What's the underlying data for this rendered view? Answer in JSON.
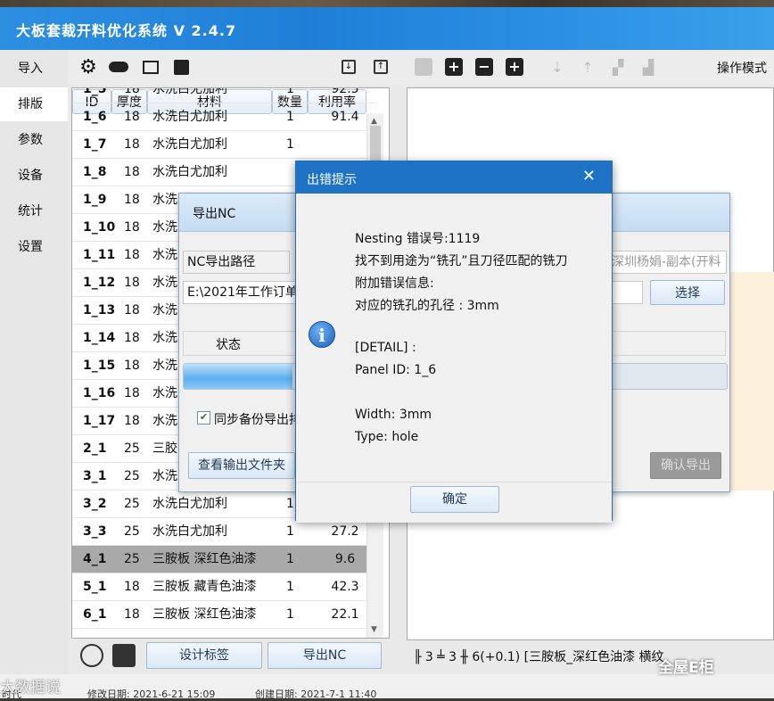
{
  "app": {
    "title": "大板套裁开料优化系统 V 2.4.7"
  },
  "nav": {
    "items": [
      "导入",
      "排版",
      "参数",
      "设备",
      "统计",
      "设置"
    ]
  },
  "toolbar": {
    "ops_mode": "操作模式"
  },
  "table": {
    "headers": [
      "ID",
      "厚度",
      "材料",
      "数量",
      "利用率"
    ],
    "top_partial": {
      "id": "1_5",
      "thickness": "18",
      "material": "水洗白尤加利",
      "qty": "1",
      "util": "92.5"
    },
    "rows": [
      {
        "id": "1_6",
        "thickness": "18",
        "material": "水洗白尤加利",
        "qty": "1",
        "util": "91.4"
      },
      {
        "id": "1_7",
        "thickness": "18",
        "material": "水洗白尤加利",
        "qty": "1",
        "util": ""
      },
      {
        "id": "1_8",
        "thickness": "18",
        "material": "水洗白尤加利",
        "qty": "",
        "util": ""
      },
      {
        "id": "1_9",
        "thickness": "18",
        "material": "水洗",
        "qty": "",
        "util": ""
      },
      {
        "id": "1_10",
        "thickness": "18",
        "material": "水洗",
        "qty": "",
        "util": ""
      },
      {
        "id": "1_11",
        "thickness": "18",
        "material": "水洗",
        "qty": "",
        "util": ""
      },
      {
        "id": "1_12",
        "thickness": "18",
        "material": "水洗",
        "qty": "",
        "util": ""
      },
      {
        "id": "1_13",
        "thickness": "18",
        "material": "水洗",
        "qty": "",
        "util": ""
      },
      {
        "id": "1_14",
        "thickness": "18",
        "material": "水洗",
        "qty": "",
        "util": ""
      },
      {
        "id": "1_15",
        "thickness": "18",
        "material": "水洗",
        "qty": "",
        "util": ""
      },
      {
        "id": "1_16",
        "thickness": "18",
        "material": "水洗",
        "qty": "",
        "util": ""
      },
      {
        "id": "1_17",
        "thickness": "18",
        "material": "水洗",
        "qty": "",
        "util": ""
      },
      {
        "id": "2_1",
        "thickness": "25",
        "material": "三胶",
        "qty": "",
        "util": ""
      },
      {
        "id": "3_1",
        "thickness": "25",
        "material": "水洗白尤加利",
        "qty": "1",
        "util": ""
      },
      {
        "id": "3_2",
        "thickness": "25",
        "material": "水洗白尤加利",
        "qty": "1",
        "util": ""
      },
      {
        "id": "3_3",
        "thickness": "25",
        "material": "水洗白尤加利",
        "qty": "1",
        "util": "27.2"
      },
      {
        "id": "4_1",
        "thickness": "25",
        "material": "三胺板 深红色油漆",
        "qty": "1",
        "util": "9.6",
        "selected": true
      },
      {
        "id": "5_1",
        "thickness": "18",
        "material": "三胺板 藏青色油漆",
        "qty": "1",
        "util": "42.3"
      },
      {
        "id": "6_1",
        "thickness": "18",
        "material": "三胺板 深红色油漆",
        "qty": "1",
        "util": "22.1"
      }
    ]
  },
  "bottom_buttons": {
    "design_label": "设计标签",
    "export_nc": "导出NC"
  },
  "status_line": "╟ 3 ╧ 3  ╫ 6(+0.1)   [三胺板_深红色油漆  横纹",
  "nc_dialog": {
    "title": "导出NC",
    "path_label": "NC导出路径",
    "path_value": "E:\\2021年工作订单",
    "name_value": "深圳杨娟-副本(开料",
    "select_button": "选择",
    "status_header": "状态",
    "progress": 0.2,
    "sync_backup": "同步备份导出排",
    "view_folder": "查看输出文件夹",
    "confirm_export": "确认导出"
  },
  "error_dialog": {
    "title": "出错提示",
    "lines": [
      "Nesting 错误号:1119",
      "找不到用途为“铣孔”且刀径匹配的铣刀",
      "附加错误信息:",
      "对应的铣孔的孔径 : 3mm",
      "",
      "[DETAIL] :",
      "Panel ID:  1_6",
      "",
      "Width:  3mm",
      "Type:  hole"
    ],
    "ok_button": "确定"
  },
  "footer": {
    "left": "时代",
    "modified": "修改日期: 2021-6-21 15:09",
    "created": "创建日期: 2021-7-1 11:40"
  },
  "watermarks": {
    "left": "大数据说",
    "right": "全屋E柜"
  }
}
